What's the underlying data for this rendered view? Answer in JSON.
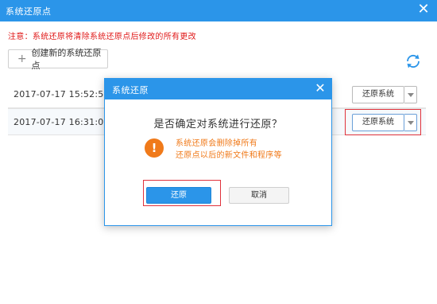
{
  "window": {
    "title": "系统还原点",
    "close_icon": "close-icon"
  },
  "warning_text": "注意：系统还原将清除系统还原点后修改的所有更改",
  "toolbar": {
    "create_label": "创建新的系统还原点",
    "create_icon": "plus-icon",
    "refresh_icon": "refresh-icon"
  },
  "restore_points": [
    {
      "date": "2017-07-17 15:52:50",
      "action_label": "还原系统"
    },
    {
      "date": "2017-07-17 16:31:00",
      "action_label": "还原系统"
    }
  ],
  "dialog": {
    "title": "系统还原",
    "question": "是否确定对系统进行还原？",
    "message_line1": "系统还原会删除掉所有",
    "message_line2": "还原点以后的新文件和程序等",
    "ok_label": "还原",
    "cancel_label": "取消",
    "warning_icon": "!"
  },
  "colors": {
    "accent": "#2b95e9",
    "warning_red": "#e01a1a",
    "alert_orange": "#f07a1a",
    "highlight_red": "#e0323c"
  }
}
